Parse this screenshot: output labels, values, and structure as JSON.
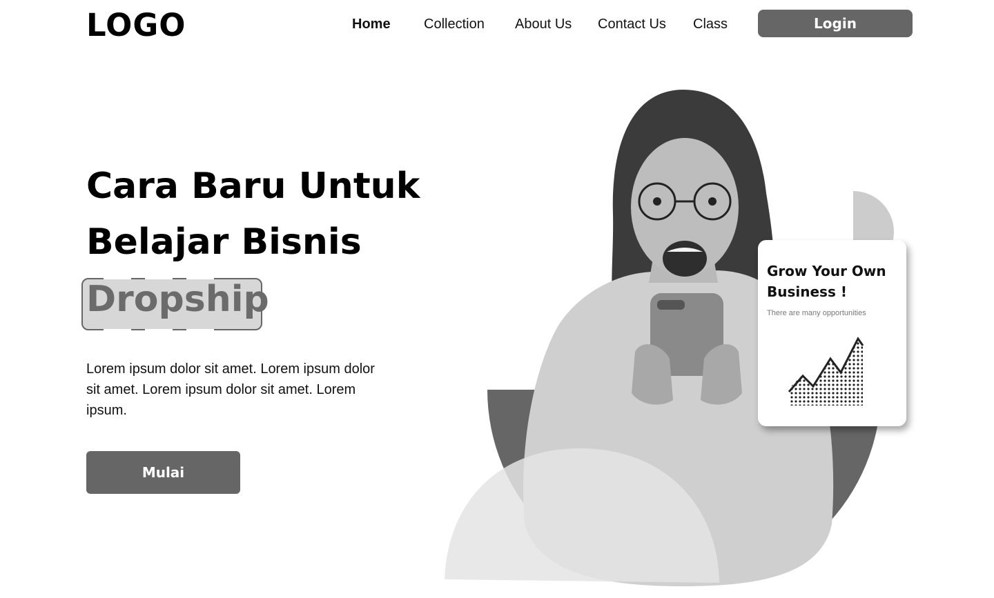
{
  "header": {
    "logo": "LOGO",
    "nav": [
      {
        "label": "Home",
        "active": true
      },
      {
        "label": "Collection",
        "active": false
      },
      {
        "label": "About Us",
        "active": false
      },
      {
        "label": "Contact Us",
        "active": false
      },
      {
        "label": "Class",
        "active": false
      }
    ],
    "login_label": "Login"
  },
  "hero": {
    "line1": "Cara Baru Untuk",
    "line2": "Belajar Bisnis",
    "highlight": "Dropship",
    "description": "Lorem ipsum dolor sit amet. Lorem ipsum dolor sit amet. Lorem ipsum dolor sit amet. Lorem ipsum.",
    "cta_label": "Mulai"
  },
  "card": {
    "title": "Grow Your Own Business !",
    "subtitle": "There are many opportunities",
    "chart_icon": "growth-chart-icon"
  },
  "colors": {
    "primary": "#666666",
    "highlight_bg": "#d7d7d7",
    "text": "#000000"
  }
}
